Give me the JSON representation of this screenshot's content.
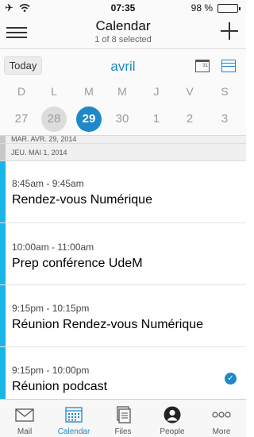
{
  "status_bar": {
    "time": "07:35",
    "battery": "98 %",
    "battery_fill": 0.98
  },
  "header": {
    "title": "Calendar",
    "subtitle": "1 of 8 selected"
  },
  "toolbar": {
    "today_label": "Today",
    "month_label": "avril",
    "day_view_number": "31"
  },
  "week": {
    "days": [
      {
        "letter": "D",
        "number": "27"
      },
      {
        "letter": "L",
        "number": "28"
      },
      {
        "letter": "M",
        "number": "29"
      },
      {
        "letter": "M",
        "number": "30"
      },
      {
        "letter": "J",
        "number": "1"
      },
      {
        "letter": "V",
        "number": "2"
      },
      {
        "letter": "S",
        "number": "3"
      }
    ],
    "selected_number": "29"
  },
  "date_headers": [
    "MAR. AVR. 29, 2014",
    "JEU. MAI 1, 2014"
  ],
  "events": [
    {
      "time": "8:45am - 9:45am",
      "title": "Rendez-vous Numérique",
      "selected": false
    },
    {
      "time": "10:00am - 11:00am",
      "title": "Prep conférence UdeM",
      "selected": false
    },
    {
      "time": "9:15pm - 10:15pm",
      "title": "Réunion Rendez-vous Numérique",
      "selected": false
    },
    {
      "time": "9:15pm - 10:00pm",
      "title": "Réunion podcast",
      "selected": true
    }
  ],
  "tabs": [
    {
      "label": "Mail",
      "icon": "envelope-icon",
      "active": false
    },
    {
      "label": "Calendar",
      "icon": "calendar-grid-icon",
      "active": true
    },
    {
      "label": "Files",
      "icon": "files-icon",
      "active": false
    },
    {
      "label": "People",
      "icon": "person-icon",
      "active": false
    },
    {
      "label": "More",
      "icon": "more-dots-icon",
      "active": false
    }
  ],
  "colors": {
    "accent": "#1e88c8",
    "event_bar": "#1ab5e8",
    "battery": "#3ac24a"
  }
}
